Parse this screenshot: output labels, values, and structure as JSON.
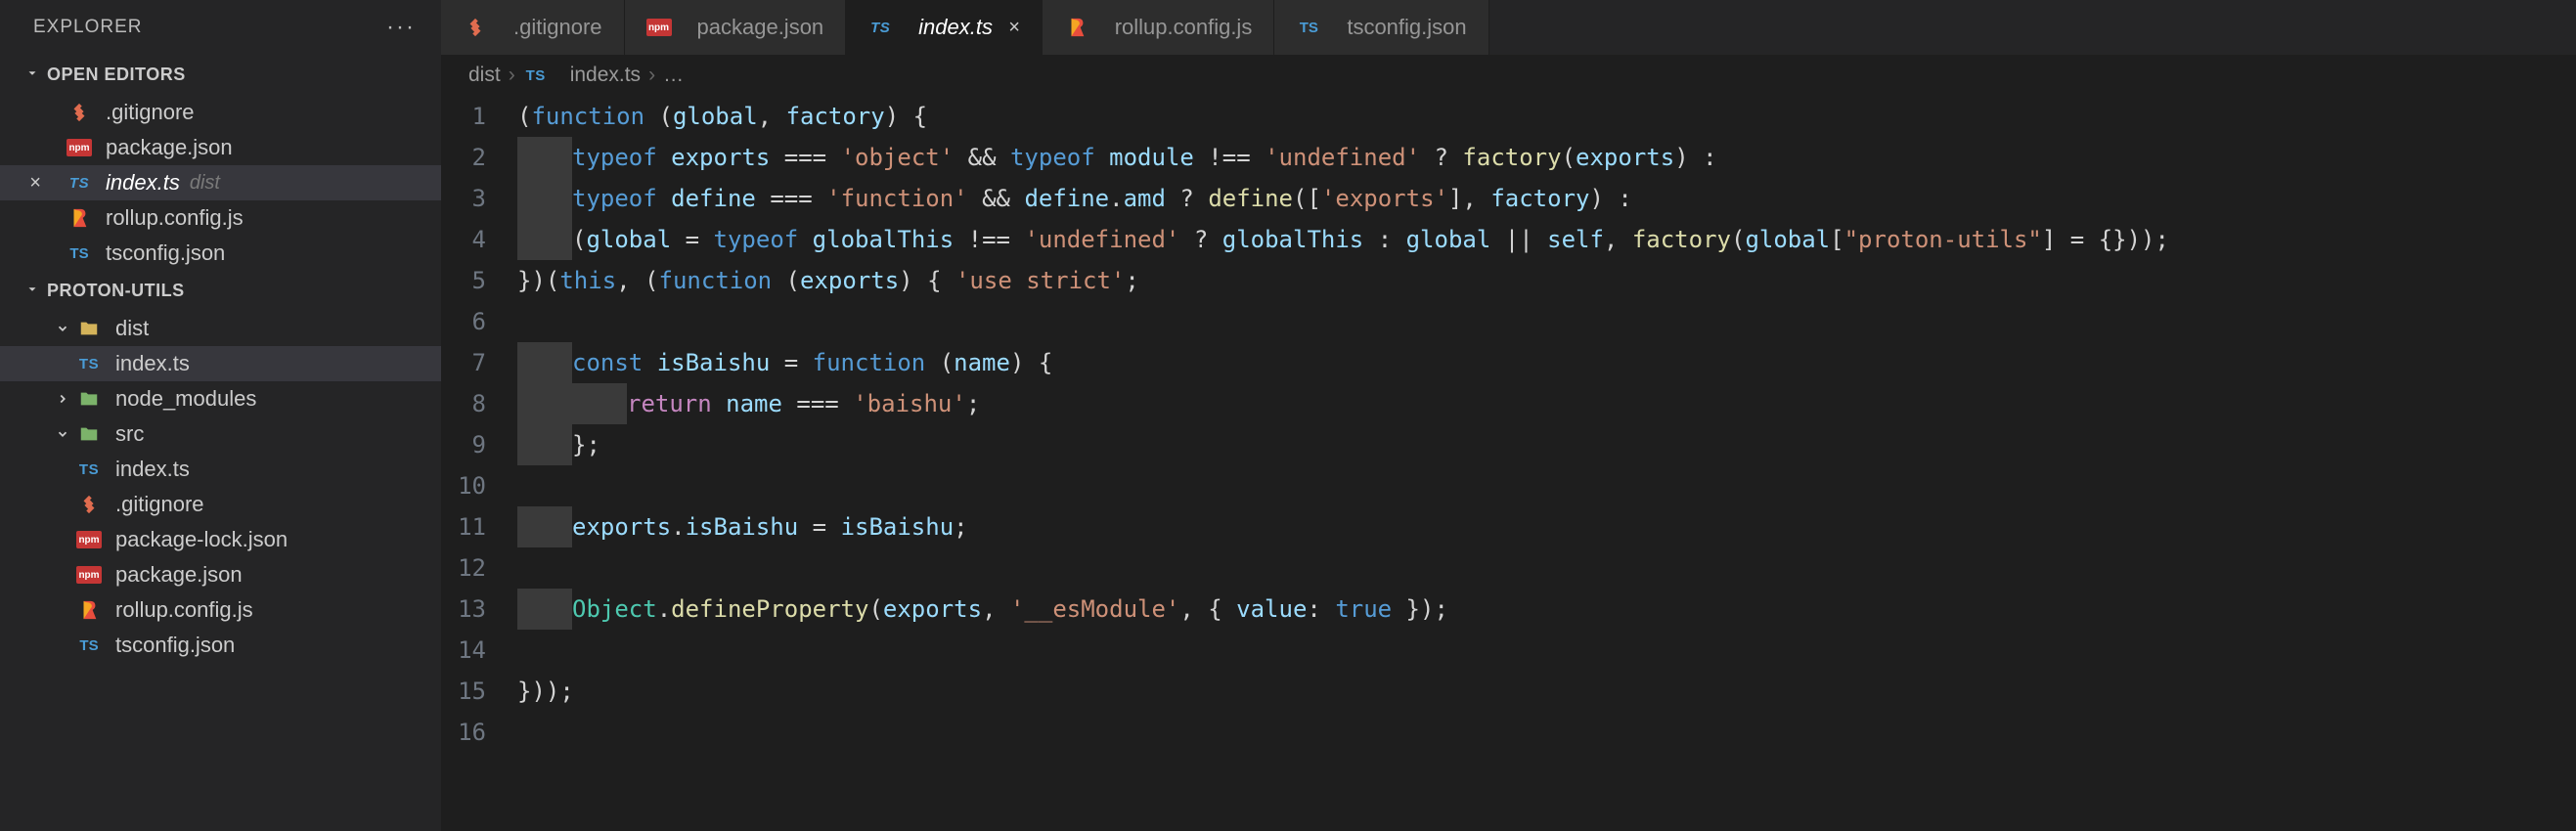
{
  "sidebar": {
    "title": "EXPLORER",
    "open_editors_label": "OPEN EDITORS",
    "project_label": "PROTON-UTILS",
    "open_editors": [
      {
        "icon": "gitignore",
        "label": ".gitignore"
      },
      {
        "icon": "npm",
        "label": "package.json"
      },
      {
        "icon": "ts",
        "label": "index.ts",
        "suffix": "dist",
        "active": true,
        "close": true
      },
      {
        "icon": "rollup",
        "label": "rollup.config.js"
      },
      {
        "icon": "tsconf",
        "label": "tsconfig.json"
      }
    ],
    "tree": [
      {
        "depth": 0,
        "chev": "down",
        "icon": "fld",
        "label": "dist",
        "kind": "folder"
      },
      {
        "depth": 1,
        "icon": "ts",
        "label": "index.ts",
        "selected": true
      },
      {
        "depth": 0,
        "chev": "right",
        "icon": "fld-g",
        "label": "node_modules",
        "kind": "folder"
      },
      {
        "depth": 0,
        "chev": "down",
        "icon": "fld-g",
        "label": "src",
        "kind": "folder"
      },
      {
        "depth": 1,
        "icon": "ts",
        "label": "index.ts"
      },
      {
        "depth": 0,
        "icon": "gitignore",
        "label": ".gitignore"
      },
      {
        "depth": 0,
        "icon": "npm",
        "label": "package-lock.json"
      },
      {
        "depth": 0,
        "icon": "npm",
        "label": "package.json"
      },
      {
        "depth": 0,
        "icon": "rollup",
        "label": "rollup.config.js"
      },
      {
        "depth": 0,
        "icon": "tsconf",
        "label": "tsconfig.json"
      }
    ]
  },
  "tabs": [
    {
      "icon": "gitignore",
      "label": ".gitignore"
    },
    {
      "icon": "npm",
      "label": "package.json"
    },
    {
      "icon": "ts",
      "label": "index.ts",
      "active": true,
      "close": true
    },
    {
      "icon": "rollup",
      "label": "rollup.config.js"
    },
    {
      "icon": "tsconf",
      "label": "tsconfig.json"
    }
  ],
  "breadcrumbs": {
    "parts": [
      "dist",
      "index.ts"
    ],
    "tail": "…",
    "file_icon": "ts"
  },
  "code": {
    "lines": [
      {
        "n": 1,
        "t": [
          [
            "pn",
            "("
          ],
          [
            "kw",
            "function"
          ],
          [
            "pn",
            " ("
          ],
          [
            "id",
            "global"
          ],
          [
            "pn",
            ", "
          ],
          [
            "id",
            "factory"
          ],
          [
            "pn",
            ") {"
          ]
        ]
      },
      {
        "n": 2,
        "indent": 4,
        "t": [
          [
            "kw",
            "typeof"
          ],
          [
            "pn",
            " "
          ],
          [
            "id",
            "exports"
          ],
          [
            "pn",
            " "
          ],
          [
            "op",
            "==="
          ],
          [
            "pn",
            " "
          ],
          [
            "str",
            "'object'"
          ],
          [
            "pn",
            " "
          ],
          [
            "op",
            "&&"
          ],
          [
            "pn",
            " "
          ],
          [
            "kw",
            "typeof"
          ],
          [
            "pn",
            " "
          ],
          [
            "id",
            "module"
          ],
          [
            "pn",
            " "
          ],
          [
            "op",
            "!=="
          ],
          [
            "pn",
            " "
          ],
          [
            "str",
            "'undefined'"
          ],
          [
            "pn",
            " "
          ],
          [
            "op",
            "?"
          ],
          [
            "pn",
            " "
          ],
          [
            "fn",
            "factory"
          ],
          [
            "pn",
            "("
          ],
          [
            "id",
            "exports"
          ],
          [
            "pn",
            ") "
          ],
          [
            "op",
            ":"
          ]
        ]
      },
      {
        "n": 3,
        "indent": 4,
        "t": [
          [
            "kw",
            "typeof"
          ],
          [
            "pn",
            " "
          ],
          [
            "id",
            "define"
          ],
          [
            "pn",
            " "
          ],
          [
            "op",
            "==="
          ],
          [
            "pn",
            " "
          ],
          [
            "str",
            "'function'"
          ],
          [
            "pn",
            " "
          ],
          [
            "op",
            "&&"
          ],
          [
            "pn",
            " "
          ],
          [
            "id",
            "define"
          ],
          [
            "pn",
            "."
          ],
          [
            "id",
            "amd"
          ],
          [
            "pn",
            " "
          ],
          [
            "op",
            "?"
          ],
          [
            "pn",
            " "
          ],
          [
            "fn",
            "define"
          ],
          [
            "pn",
            "(["
          ],
          [
            "str",
            "'exports'"
          ],
          [
            "pn",
            "], "
          ],
          [
            "id",
            "factory"
          ],
          [
            "pn",
            ") "
          ],
          [
            "op",
            ":"
          ]
        ]
      },
      {
        "n": 4,
        "indent": 4,
        "t": [
          [
            "pn",
            "("
          ],
          [
            "id",
            "global"
          ],
          [
            "pn",
            " "
          ],
          [
            "op",
            "="
          ],
          [
            "pn",
            " "
          ],
          [
            "kw",
            "typeof"
          ],
          [
            "pn",
            " "
          ],
          [
            "id",
            "globalThis"
          ],
          [
            "pn",
            " "
          ],
          [
            "op",
            "!=="
          ],
          [
            "pn",
            " "
          ],
          [
            "str",
            "'undefined'"
          ],
          [
            "pn",
            " "
          ],
          [
            "op",
            "?"
          ],
          [
            "pn",
            " "
          ],
          [
            "id",
            "globalThis"
          ],
          [
            "pn",
            " "
          ],
          [
            "op",
            ":"
          ],
          [
            "pn",
            " "
          ],
          [
            "id",
            "global"
          ],
          [
            "pn",
            " "
          ],
          [
            "op",
            "||"
          ],
          [
            "pn",
            " "
          ],
          [
            "id",
            "self"
          ],
          [
            "pn",
            ", "
          ],
          [
            "fn",
            "factory"
          ],
          [
            "pn",
            "("
          ],
          [
            "id",
            "global"
          ],
          [
            "pn",
            "["
          ],
          [
            "str",
            "\"proton-utils\""
          ],
          [
            "pn",
            "] "
          ],
          [
            "op",
            "="
          ],
          [
            "pn",
            " {}));"
          ]
        ]
      },
      {
        "n": 5,
        "t": [
          [
            "pn",
            "})("
          ],
          [
            "const",
            "this"
          ],
          [
            "pn",
            ", ("
          ],
          [
            "kw",
            "function"
          ],
          [
            "pn",
            " ("
          ],
          [
            "id",
            "exports"
          ],
          [
            "pn",
            ") { "
          ],
          [
            "str",
            "'use strict'"
          ],
          [
            "pn",
            ";"
          ]
        ]
      },
      {
        "n": 6,
        "t": []
      },
      {
        "n": 7,
        "indent": 4,
        "t": [
          [
            "kw",
            "const"
          ],
          [
            "pn",
            " "
          ],
          [
            "id",
            "isBaishu"
          ],
          [
            "pn",
            " "
          ],
          [
            "op",
            "="
          ],
          [
            "pn",
            " "
          ],
          [
            "kw",
            "function"
          ],
          [
            "pn",
            " ("
          ],
          [
            "id",
            "name"
          ],
          [
            "pn",
            ") {"
          ]
        ]
      },
      {
        "n": 8,
        "indent": 8,
        "t": [
          [
            "ctrl",
            "return"
          ],
          [
            "pn",
            " "
          ],
          [
            "id",
            "name"
          ],
          [
            "pn",
            " "
          ],
          [
            "op",
            "==="
          ],
          [
            "pn",
            " "
          ],
          [
            "str",
            "'baishu'"
          ],
          [
            "pn",
            ";"
          ]
        ]
      },
      {
        "n": 9,
        "indent": 4,
        "t": [
          [
            "pn",
            "};"
          ]
        ]
      },
      {
        "n": 10,
        "t": []
      },
      {
        "n": 11,
        "indent": 4,
        "t": [
          [
            "id",
            "exports"
          ],
          [
            "pn",
            "."
          ],
          [
            "id",
            "isBaishu"
          ],
          [
            "pn",
            " "
          ],
          [
            "op",
            "="
          ],
          [
            "pn",
            " "
          ],
          [
            "id",
            "isBaishu"
          ],
          [
            "pn",
            ";"
          ]
        ]
      },
      {
        "n": 12,
        "t": []
      },
      {
        "n": 13,
        "indent": 4,
        "t": [
          [
            "obj",
            "Object"
          ],
          [
            "pn",
            "."
          ],
          [
            "fn",
            "defineProperty"
          ],
          [
            "pn",
            "("
          ],
          [
            "id",
            "exports"
          ],
          [
            "pn",
            ", "
          ],
          [
            "str",
            "'__esModule'"
          ],
          [
            "pn",
            ", { "
          ],
          [
            "id",
            "value"
          ],
          [
            "op",
            ":"
          ],
          [
            "pn",
            " "
          ],
          [
            "const",
            "true"
          ],
          [
            "pn",
            " });"
          ]
        ]
      },
      {
        "n": 14,
        "t": []
      },
      {
        "n": 15,
        "t": [
          [
            "pn",
            "}));"
          ]
        ]
      },
      {
        "n": 16,
        "t": []
      }
    ]
  }
}
